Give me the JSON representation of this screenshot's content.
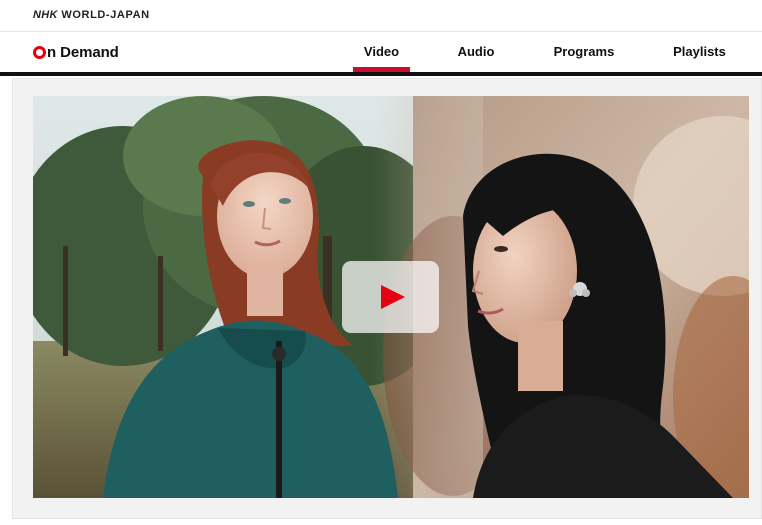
{
  "brand": {
    "nhk": "NHK",
    "world": "WORLD-JAPAN"
  },
  "logo": {
    "o": "O",
    "rest": "n Demand"
  },
  "nav": {
    "tabs": [
      {
        "label": "Video",
        "active": true
      },
      {
        "label": "Audio",
        "active": false
      },
      {
        "label": "Programs",
        "active": false
      },
      {
        "label": "Playlists",
        "active": false
      }
    ]
  },
  "colors": {
    "accent": "#e60012",
    "active_underline": "#c8102e",
    "navbar_rule": "#111111"
  },
  "player": {
    "icon": "play-icon"
  }
}
